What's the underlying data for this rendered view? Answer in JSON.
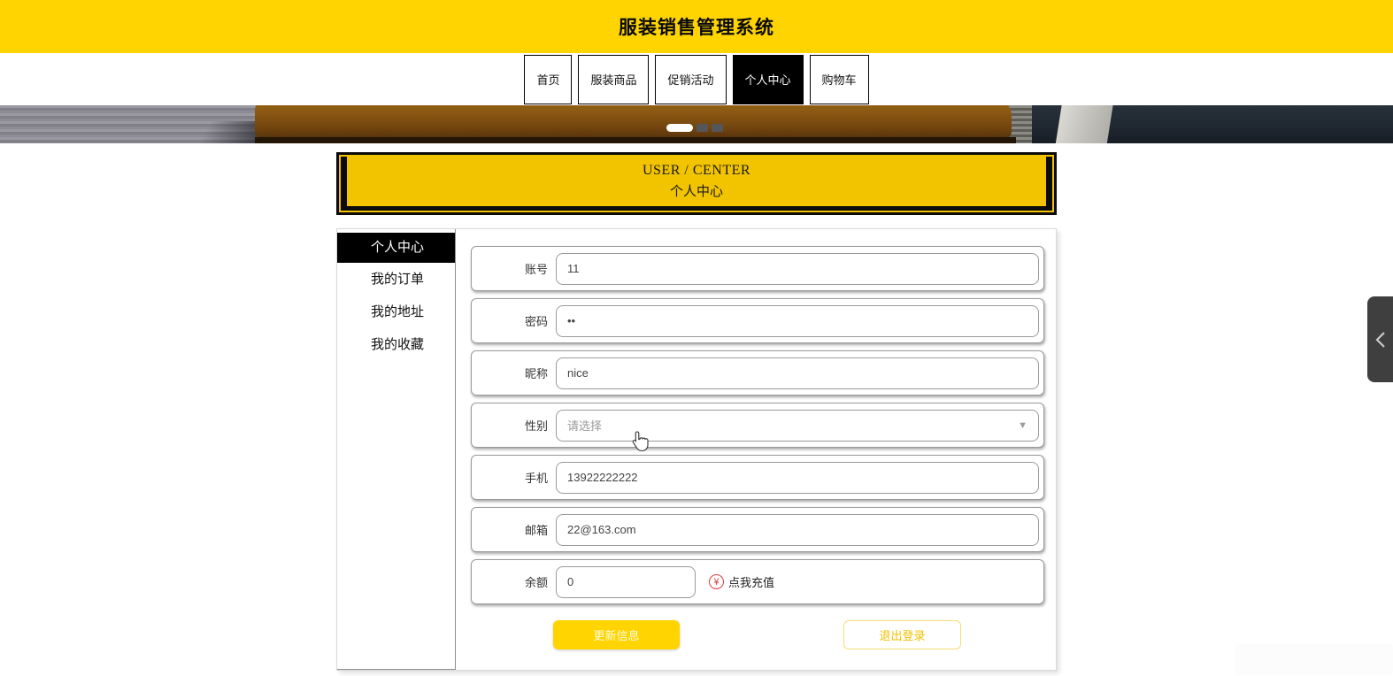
{
  "header": {
    "title": "服装销售管理系统"
  },
  "nav": {
    "tabs": [
      {
        "label": "首页",
        "active": false
      },
      {
        "label": "服装商品",
        "active": false
      },
      {
        "label": "促销活动",
        "active": false
      },
      {
        "label": "个人中心",
        "active": true
      },
      {
        "label": "购物车",
        "active": false
      }
    ]
  },
  "carousel": {
    "slide_count": 3,
    "active_index": 0
  },
  "section_banner": {
    "title_en": "USER / CENTER",
    "title_zh": "个人中心"
  },
  "sidebar": {
    "items": [
      {
        "label": "个人中心",
        "active": true
      },
      {
        "label": "我的订单",
        "active": false
      },
      {
        "label": "我的地址",
        "active": false
      },
      {
        "label": "我的收藏",
        "active": false
      }
    ]
  },
  "form": {
    "rows": [
      {
        "label": "账号",
        "value": "11",
        "type": "text"
      },
      {
        "label": "密码",
        "value": "••",
        "type": "password"
      },
      {
        "label": "昵称",
        "value": "nice",
        "type": "text"
      },
      {
        "label": "性别",
        "value": "请选择",
        "type": "select"
      },
      {
        "label": "手机",
        "value": "13922222222",
        "type": "text"
      },
      {
        "label": "邮箱",
        "value": "22@163.com",
        "type": "text"
      },
      {
        "label": "余额",
        "value": "0",
        "type": "balance",
        "currency": "¥",
        "recharge_label": "点我充值"
      }
    ],
    "buttons": {
      "update": "更新信息",
      "logout": "退出登录"
    }
  },
  "icons": {
    "select_caret": "▼",
    "drawer_chevron": "left-chevron"
  },
  "colors": {
    "brand_yellow": "#ffd400",
    "banner_yellow": "#f2c400",
    "active_black": "#000000",
    "recharge_red": "#e23c3c"
  }
}
